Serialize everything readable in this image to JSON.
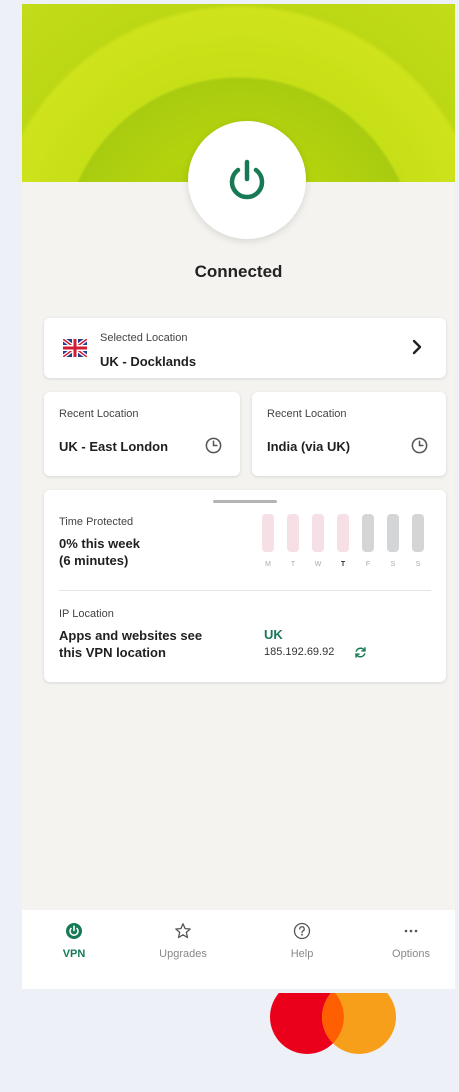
{
  "app": {
    "status": "Connected",
    "colors": {
      "accent": "#177a55",
      "hero": "#b8d70f",
      "background": "#f4f3ef"
    }
  },
  "selected_location": {
    "label": "Selected Location",
    "value": "UK - Docklands",
    "flag_icon": "uk-flag-icon"
  },
  "recent_locations": [
    {
      "label": "Recent Location",
      "value": "UK - East London"
    },
    {
      "label": "Recent Location",
      "value": "India (via UK)"
    }
  ],
  "time_protected": {
    "label": "Time Protected",
    "value_line1": "0% this week",
    "value_line2": "(6 minutes)",
    "days": [
      {
        "day": "M",
        "state": "past"
      },
      {
        "day": "T",
        "state": "past"
      },
      {
        "day": "W",
        "state": "past"
      },
      {
        "day": "T",
        "state": "today"
      },
      {
        "day": "F",
        "state": "future"
      },
      {
        "day": "S",
        "state": "future"
      },
      {
        "day": "S",
        "state": "future"
      }
    ]
  },
  "ip_location": {
    "label": "IP Location",
    "desc_line1": "Apps and websites see",
    "desc_line2": "this VPN location",
    "country": "UK",
    "ip": "185.192.69.92"
  },
  "nav": {
    "items": [
      {
        "label": "VPN",
        "icon": "power-icon",
        "active": true
      },
      {
        "label": "Upgrades",
        "icon": "star-icon",
        "active": false
      },
      {
        "label": "Help",
        "icon": "help-icon",
        "active": false
      },
      {
        "label": "Options",
        "icon": "more-icon",
        "active": false
      }
    ]
  }
}
